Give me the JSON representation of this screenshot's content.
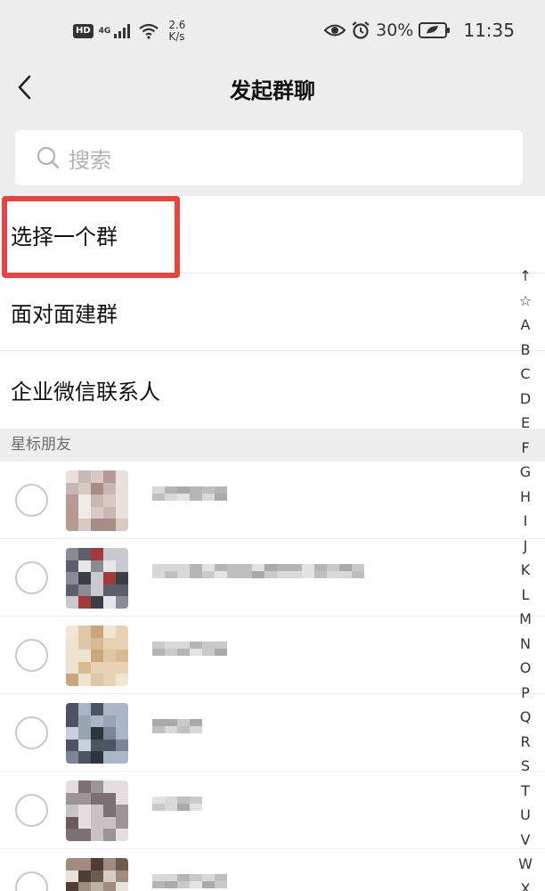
{
  "status_bar": {
    "hd_badge": "HD",
    "network_type": "4G",
    "net_speed_value": "2.6",
    "net_speed_unit": "K/s",
    "battery": "30%",
    "time": "11:35",
    "icons": [
      "eye-icon",
      "alarm-icon",
      "battery-icon"
    ]
  },
  "nav": {
    "title": "发起群聊",
    "back_icon": "chevron-left-icon"
  },
  "search": {
    "placeholder": "搜索",
    "icon": "search-icon"
  },
  "menu": {
    "items": [
      {
        "label": "选择一个群"
      },
      {
        "label": "面对面建群"
      },
      {
        "label": "企业微信联系人"
      }
    ],
    "highlight_color": "#e8433f"
  },
  "section": {
    "starred_friends": "星标朋友"
  },
  "contacts": [
    {
      "name_hidden": true
    },
    {
      "name_hidden": true
    },
    {
      "name_hidden": true
    },
    {
      "name_hidden": true
    },
    {
      "name_hidden": true
    },
    {
      "name_hidden": true
    }
  ],
  "index_bar": [
    "↑",
    "☆",
    "A",
    "B",
    "C",
    "D",
    "E",
    "F",
    "G",
    "H",
    "I",
    "J",
    "K",
    "L",
    "M",
    "N",
    "O",
    "P",
    "Q",
    "R",
    "S",
    "T",
    "U",
    "V",
    "W",
    "X"
  ]
}
